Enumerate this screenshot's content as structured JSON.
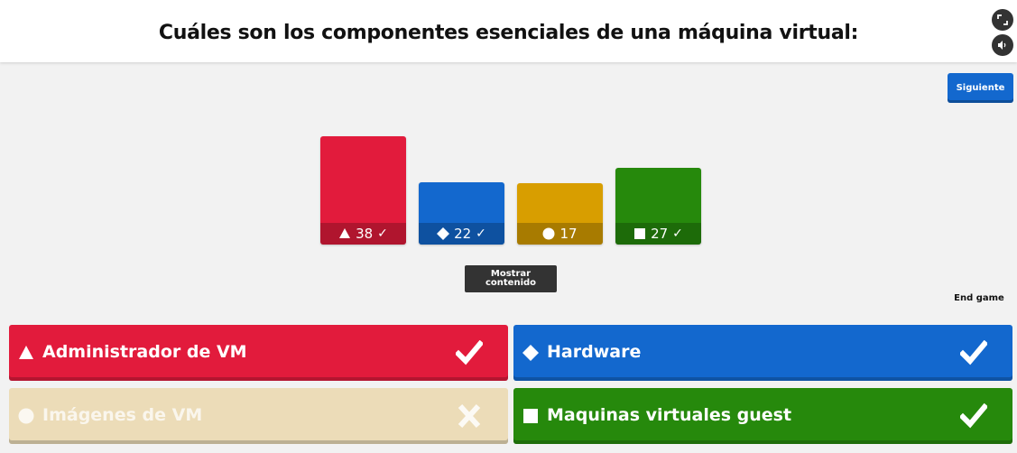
{
  "question": "Cuáles son los componentes esenciales de una máquina virtual:",
  "header_icons": [
    "fullscreen-icon",
    "volume-icon"
  ],
  "next_label": "Siguiente",
  "show_media_label": "Mostrar contenido",
  "end_game_label": "End game",
  "chart_data": {
    "type": "bar",
    "categories": [
      "triangle",
      "diamond",
      "circle",
      "square"
    ],
    "values": [
      38,
      22,
      17,
      27
    ],
    "correct": [
      true,
      true,
      false,
      true
    ],
    "colors": [
      "#e21b3c",
      "#1368ce",
      "#d89e00",
      "#26890c"
    ]
  },
  "answers": [
    {
      "shape": "triangle",
      "text": "Administrador de VM",
      "correct": true,
      "color": "#e21b3c"
    },
    {
      "shape": "diamond",
      "text": "Hardware",
      "correct": true,
      "color": "#1368ce"
    },
    {
      "shape": "circle",
      "text": "Imágenes de VM",
      "correct": false,
      "color": "#ecdcb8"
    },
    {
      "shape": "square",
      "text": "Maquinas virtuales guest",
      "correct": true,
      "color": "#26890c"
    }
  ]
}
